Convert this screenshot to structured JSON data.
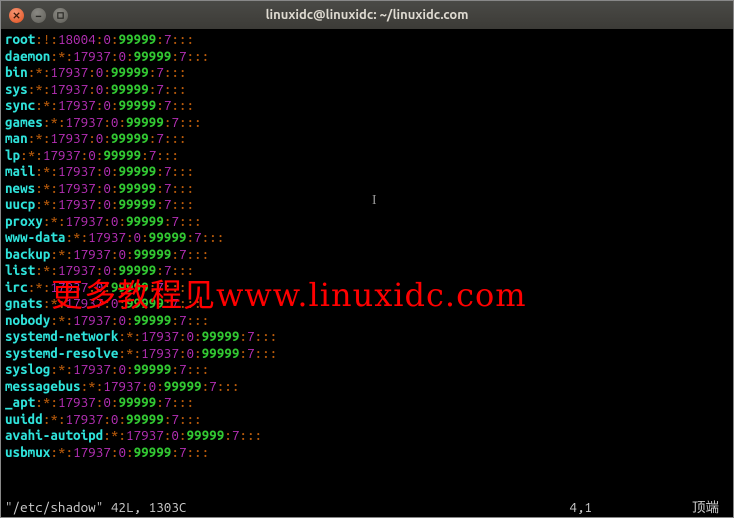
{
  "window": {
    "title": "linuxidc@linuxidc: ~/linuxidc.com"
  },
  "lines": [
    {
      "user": "root",
      "sep": ":",
      "pw": "!",
      "f1": "18004",
      "f2": "0",
      "f3": "99999",
      "f4": "7"
    },
    {
      "user": "daemon",
      "sep": ":",
      "pw": "*",
      "f1": "17937",
      "f2": "0",
      "f3": "99999",
      "f4": "7"
    },
    {
      "user": "bin",
      "sep": ":",
      "pw": "*",
      "f1": "17937",
      "f2": "0",
      "f3": "99999",
      "f4": "7"
    },
    {
      "user": "sys",
      "sep": ":",
      "pw": "*",
      "f1": "17937",
      "f2": "0",
      "f3": "99999",
      "f4": "7"
    },
    {
      "user": "sync",
      "sep": ":",
      "pw": "*",
      "f1": "17937",
      "f2": "0",
      "f3": "99999",
      "f4": "7"
    },
    {
      "user": "games",
      "sep": ":",
      "pw": "*",
      "f1": "17937",
      "f2": "0",
      "f3": "99999",
      "f4": "7"
    },
    {
      "user": "man",
      "sep": ":",
      "pw": "*",
      "f1": "17937",
      "f2": "0",
      "f3": "99999",
      "f4": "7"
    },
    {
      "user": "lp",
      "sep": ":",
      "pw": "*",
      "f1": "17937",
      "f2": "0",
      "f3": "99999",
      "f4": "7"
    },
    {
      "user": "mail",
      "sep": ":",
      "pw": "*",
      "f1": "17937",
      "f2": "0",
      "f3": "99999",
      "f4": "7"
    },
    {
      "user": "news",
      "sep": ":",
      "pw": "*",
      "f1": "17937",
      "f2": "0",
      "f3": "99999",
      "f4": "7"
    },
    {
      "user": "uucp",
      "sep": ":",
      "pw": "*",
      "f1": "17937",
      "f2": "0",
      "f3": "99999",
      "f4": "7"
    },
    {
      "user": "proxy",
      "sep": ":",
      "pw": "*",
      "f1": "17937",
      "f2": "0",
      "f3": "99999",
      "f4": "7"
    },
    {
      "user": "www-data",
      "sep": ":",
      "pw": "*",
      "f1": "17937",
      "f2": "0",
      "f3": "99999",
      "f4": "7"
    },
    {
      "user": "backup",
      "sep": ":",
      "pw": "*",
      "f1": "17937",
      "f2": "0",
      "f3": "99999",
      "f4": "7"
    },
    {
      "user": "list",
      "sep": ":",
      "pw": "*",
      "f1": "17937",
      "f2": "0",
      "f3": "99999",
      "f4": "7"
    },
    {
      "user": "irc",
      "sep": ":",
      "pw": "*",
      "f1": "17937",
      "f2": "0",
      "f3": "99999",
      "f4": "7"
    },
    {
      "user": "gnats",
      "sep": ":",
      "pw": "*",
      "f1": "17937",
      "f2": "0",
      "f3": "99999",
      "f4": "7"
    },
    {
      "user": "nobody",
      "sep": ":",
      "pw": "*",
      "f1": "17937",
      "f2": "0",
      "f3": "99999",
      "f4": "7"
    },
    {
      "user": "systemd-network",
      "sep": ":",
      "pw": "*",
      "f1": "17937",
      "f2": "0",
      "f3": "99999",
      "f4": "7"
    },
    {
      "user": "systemd-resolve",
      "sep": ":",
      "pw": "*",
      "f1": "17937",
      "f2": "0",
      "f3": "99999",
      "f4": "7"
    },
    {
      "user": "syslog",
      "sep": ":",
      "pw": "*",
      "f1": "17937",
      "f2": "0",
      "f3": "99999",
      "f4": "7"
    },
    {
      "user": "messagebus",
      "sep": ":",
      "pw": "*",
      "f1": "17937",
      "f2": "0",
      "f3": "99999",
      "f4": "7"
    },
    {
      "user": "_apt",
      "sep": ":",
      "pw": "*",
      "f1": "17937",
      "f2": "0",
      "f3": "99999",
      "f4": "7"
    },
    {
      "user": "uuidd",
      "sep": ":",
      "pw": "*",
      "f1": "17937",
      "f2": "0",
      "f3": "99999",
      "f4": "7"
    },
    {
      "user": "avahi-autoipd",
      "sep": ":",
      "pw": "*",
      "f1": "17937",
      "f2": "0",
      "f3": "99999",
      "f4": "7"
    },
    {
      "user": "usbmux",
      "sep": ":",
      "pw": "*",
      "f1": "17937",
      "f2": "0",
      "f3": "99999",
      "f4": "7"
    }
  ],
  "status": {
    "file": "\"/etc/shadow\" 42L, 1303C",
    "position": "4,1",
    "scroll": "顶端"
  },
  "watermark": "更多教程见www.linuxidc.com"
}
